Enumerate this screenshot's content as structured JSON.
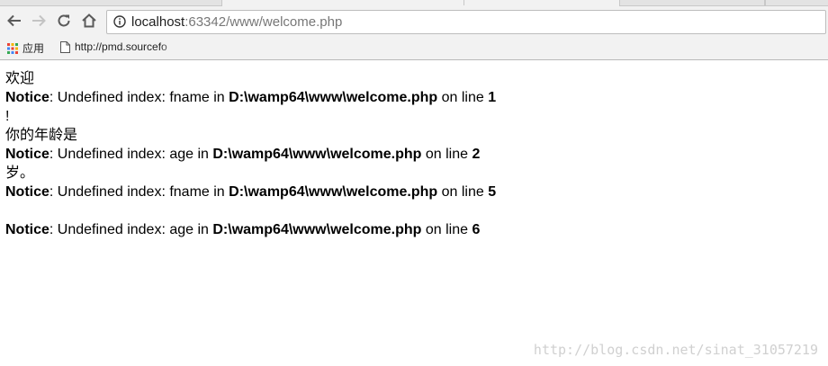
{
  "browser": {
    "url_host": "localhost",
    "url_rest": ":63342/www/welcome.php",
    "bookmarks": [
      {
        "label": "应用",
        "icon": "apps-grid-icon"
      },
      {
        "label": "http://pmd.sourcefo",
        "icon": "page-icon"
      }
    ]
  },
  "page": {
    "greeting": "欢迎",
    "notice_label": "Notice",
    "notices": [
      {
        "msg": ": Undefined index: fname in ",
        "file": "D:\\wamp64\\www\\welcome.php",
        "on_line": " on line ",
        "line_no": "1"
      },
      {
        "msg": ": Undefined index: age in ",
        "file": "D:\\wamp64\\www\\welcome.php",
        "on_line": " on line ",
        "line_no": "2"
      },
      {
        "msg": ": Undefined index: fname in ",
        "file": "D:\\wamp64\\www\\welcome.php",
        "on_line": " on line ",
        "line_no": "5"
      },
      {
        "msg": ": Undefined index: age in ",
        "file": "D:\\wamp64\\www\\welcome.php",
        "on_line": " on line ",
        "line_no": "6"
      }
    ],
    "exclamation": "!",
    "age_prefix": "你的年龄是",
    "age_suffix": "岁。"
  },
  "watermark": "http://blog.csdn.net/sinat_31057219",
  "colors": {
    "chrome_bg": "#f2f2f2",
    "icon_gray": "#5a5a5a",
    "icon_disabled": "#c4c4c4"
  }
}
